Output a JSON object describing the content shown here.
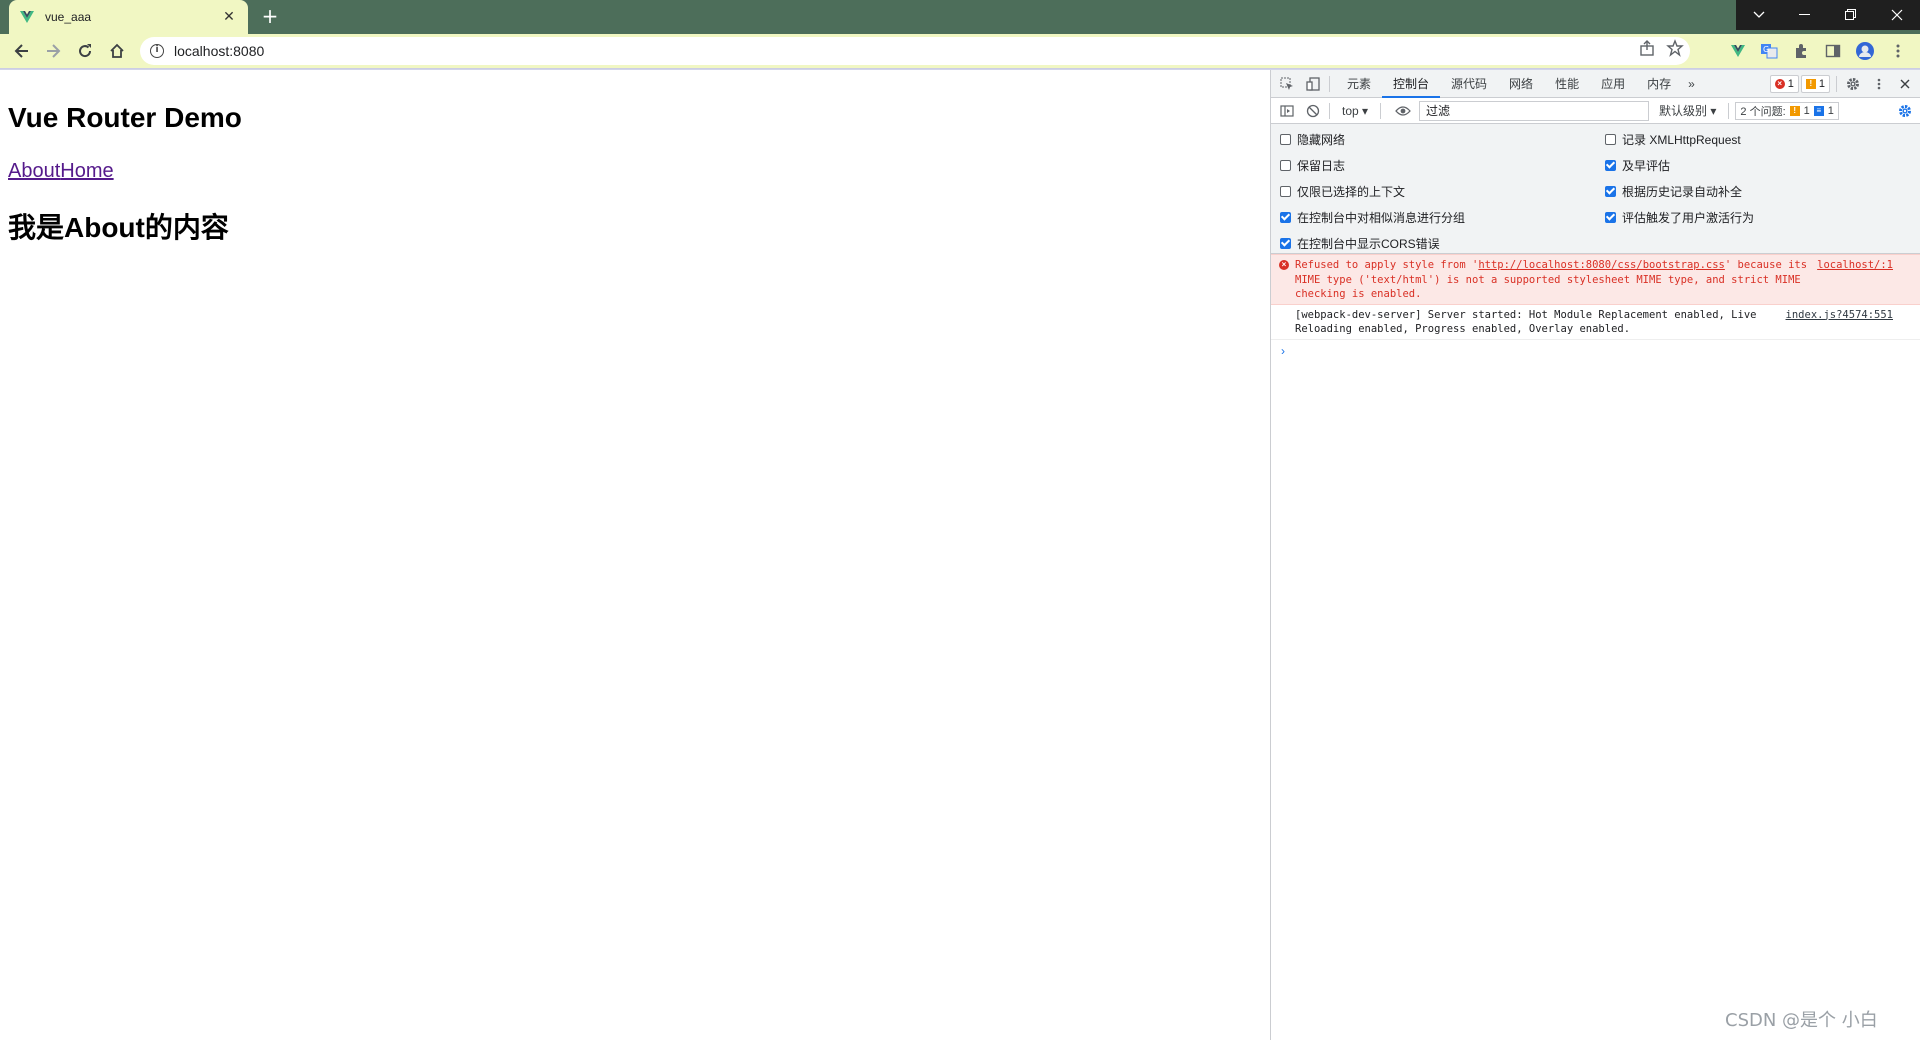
{
  "browser": {
    "tab_title": "vue_aaa",
    "new_tab": "+",
    "url": "localhost:8080"
  },
  "page": {
    "heading": "Vue Router Demo",
    "link_about": "About",
    "link_home": "Home",
    "content": "我是About的内容"
  },
  "devtools": {
    "tabs": [
      "元素",
      "控制台",
      "源代码",
      "网络",
      "性能",
      "应用",
      "内存"
    ],
    "more": "»",
    "error_count": "1",
    "warning_count": "1",
    "context": "top",
    "filter_placeholder": "过滤",
    "levels": "默认级别",
    "issues_label": "2 个问题:",
    "issues_warn": "1",
    "issues_info": "1",
    "settings_left": [
      {
        "label": "隐藏网络",
        "checked": false
      },
      {
        "label": "保留日志",
        "checked": false
      },
      {
        "label": "仅限已选择的上下文",
        "checked": false
      },
      {
        "label": "在控制台中对相似消息进行分组",
        "checked": true
      },
      {
        "label": "在控制台中显示CORS错误",
        "checked": true
      }
    ],
    "settings_right": [
      {
        "label": "记录 XMLHttpRequest",
        "checked": false
      },
      {
        "label": "及早评估",
        "checked": true
      },
      {
        "label": "根据历史记录自动补全",
        "checked": true
      },
      {
        "label": "评估触发了用户激活行为",
        "checked": true
      }
    ],
    "messages": [
      {
        "type": "error",
        "text_before": "Refused to apply style from '",
        "link": "http://localhost:8080/css/bootstrap.css",
        "text_after": "' because its MIME type ('text/html') is not a supported stylesheet MIME type, and strict MIME checking is enabled.",
        "source": "localhost/:1"
      },
      {
        "type": "log",
        "text": "[webpack-dev-server] Server started: Hot Module Replacement enabled, Live Reloading enabled, Progress enabled, Overlay enabled.",
        "source": "index.js?4574:551"
      }
    ],
    "prompt": "›"
  },
  "watermark": "CSDN @是个  小白",
  "colors": {
    "titlebar": "#4d6e5a",
    "toolbar": "#f1f7c3",
    "accent": "#1a73e8",
    "error": "#d93025"
  }
}
